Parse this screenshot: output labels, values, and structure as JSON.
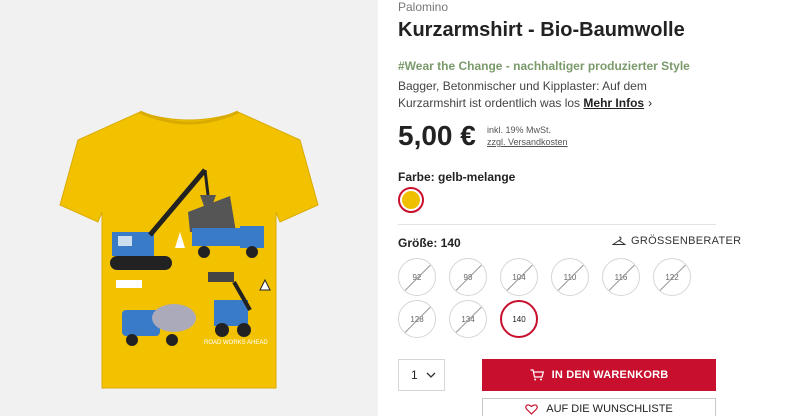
{
  "product": {
    "brand": "Palomino",
    "title": "Kurzarmshirt - Bio-Baumwolle",
    "tagline": "#Wear the Change - nachhaltiger produzierter Style",
    "description": "Bagger, Betonmischer und Kipplaster: Auf dem Kurzarmshirt ist ordentlich was los",
    "more_info": "Mehr Infos",
    "image_text": "ROAD WORKS AHEAD"
  },
  "price": {
    "amount": "5,00 €",
    "vat_note": "inkl. 19% MwSt.",
    "shipping_note": "zzgl. Versandkosten"
  },
  "color": {
    "label": "Farbe: gelb-melange",
    "swatch_hex": "#f0c000"
  },
  "size": {
    "label": "Größe: 140",
    "advisor": "GRÖSSENBERATER",
    "options": [
      {
        "label": "92",
        "available": false,
        "selected": false
      },
      {
        "label": "98",
        "available": false,
        "selected": false
      },
      {
        "label": "104",
        "available": false,
        "selected": false
      },
      {
        "label": "110",
        "available": false,
        "selected": false
      },
      {
        "label": "116",
        "available": false,
        "selected": false
      },
      {
        "label": "122",
        "available": false,
        "selected": false
      },
      {
        "label": "128",
        "available": false,
        "selected": false
      },
      {
        "label": "134",
        "available": false,
        "selected": false
      },
      {
        "label": "140",
        "available": true,
        "selected": true
      }
    ]
  },
  "cart": {
    "quantity": "1",
    "add_to_cart": "IN DEN WARENKORB",
    "wishlist": "AUF DIE WUNSCHLISTE"
  },
  "colors": {
    "accent": "#c8102e",
    "tagline": "#7a9a6a",
    "shirt": "#f2c200"
  },
  "icons": {
    "chevron": "chevron-right-icon",
    "hanger": "hanger-icon",
    "cart": "cart-icon",
    "heart": "heart-icon",
    "dropdown": "chevron-down-icon"
  }
}
